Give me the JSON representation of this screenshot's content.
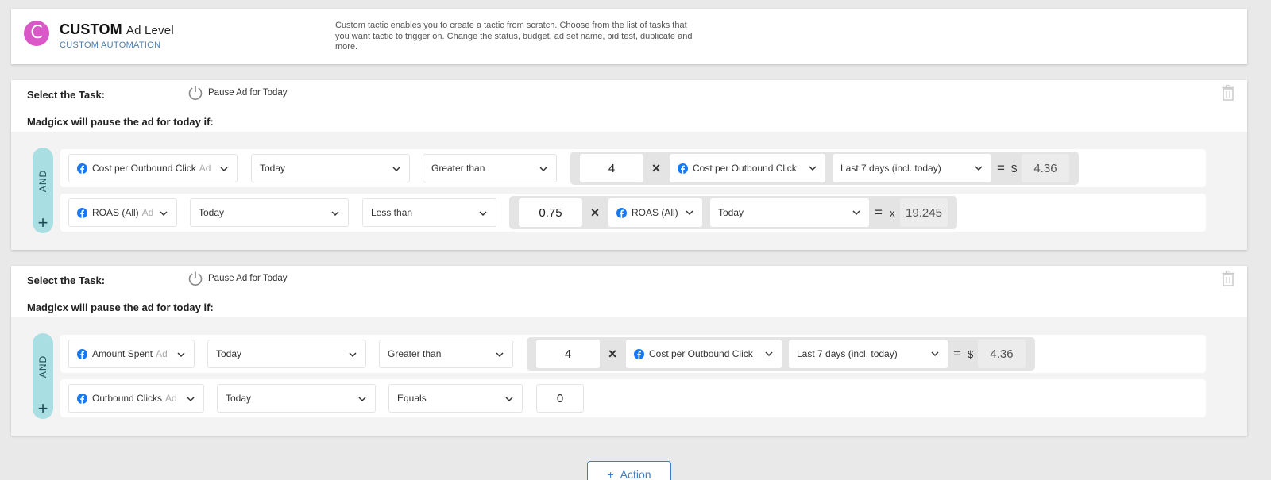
{
  "header": {
    "logo_letter": "C",
    "title": "CUSTOM",
    "level": "Ad Level",
    "subtitle": "CUSTOM AUTOMATION",
    "description": "Custom tactic enables you to create a tactic from scratch. Choose from the list of tasks that you want tactic to trigger on. Change the status, budget, ad set name, bid test, duplicate and more.",
    "logo_color": "#d957c6"
  },
  "rules": [
    {
      "select_label": "Select the Task:",
      "task": "Pause Ad for Today",
      "condition_label": "Madgicx will pause the ad for today if:",
      "and_label": "AND",
      "plus": "+",
      "conditions": [
        {
          "metric": "Cost per Outbound Click",
          "metric_tag": "Ad",
          "period": "Today",
          "operator": "Greater than",
          "multiplier": "4",
          "times": "×",
          "ref_metric": "Cost per Outbound Click",
          "ref_period": "Last 7 days (incl. today)",
          "equals": "=",
          "unit": "$",
          "result": "4.36"
        },
        {
          "metric": "ROAS (All)",
          "metric_tag": "Ad",
          "period": "Today",
          "operator": "Less than",
          "multiplier": "0.75",
          "times": "×",
          "ref_metric": "ROAS (All)",
          "ref_period": "Today",
          "equals": "=",
          "unit": "x",
          "result": "19.245"
        }
      ]
    },
    {
      "select_label": "Select the Task:",
      "task": "Pause Ad for Today",
      "condition_label": "Madgicx will pause the ad for today if:",
      "and_label": "AND",
      "plus": "+",
      "conditions": [
        {
          "metric": "Amount Spent",
          "metric_tag": "Ad",
          "period": "Today",
          "operator": "Greater than",
          "multiplier": "4",
          "times": "×",
          "ref_metric": "Cost per Outbound Click",
          "ref_period": "Last 7 days (incl. today)",
          "equals": "=",
          "unit": "$",
          "result": "4.36"
        },
        {
          "metric": "Outbound Clicks",
          "metric_tag": "Ad",
          "period": "Today",
          "operator": "Equals",
          "value": "0"
        }
      ]
    }
  ],
  "action_button": {
    "plus": "+",
    "label": "Action"
  },
  "colors": {
    "and_pill": "#a9dee3",
    "accent_blue": "#3d7fc4",
    "facebook_blue": "#1877f2"
  },
  "icons": {
    "task": "power-icon",
    "delete": "trash-icon",
    "metric": "facebook-icon",
    "dropdown": "chevron-down-icon"
  }
}
